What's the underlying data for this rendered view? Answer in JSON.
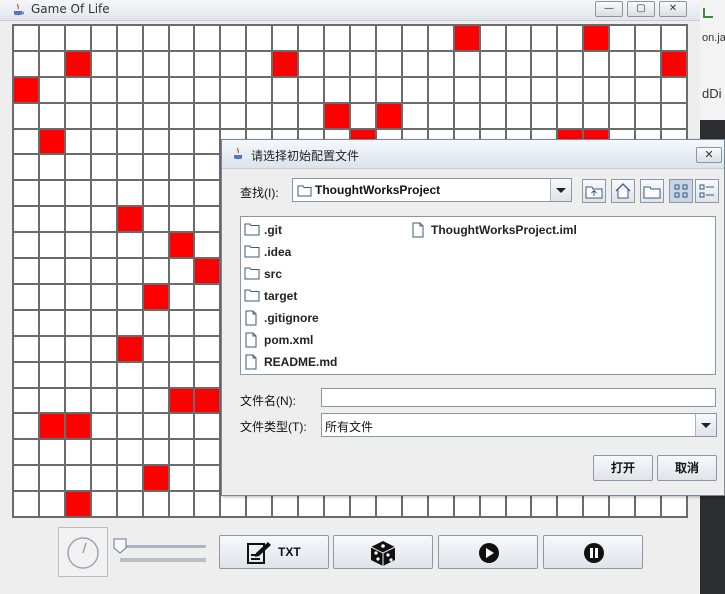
{
  "window": {
    "title": "Game Of Life",
    "minimize_glyph": "—",
    "maximize_glyph": "▢",
    "close_glyph": "✕"
  },
  "board": {
    "cols": 26,
    "rows": 19,
    "alive_color": "#ff0000",
    "alive_cells": [
      [
        0,
        17
      ],
      [
        0,
        22
      ],
      [
        1,
        2
      ],
      [
        1,
        10
      ],
      [
        1,
        25
      ],
      [
        2,
        0
      ],
      [
        3,
        12
      ],
      [
        3,
        14
      ],
      [
        4,
        1
      ],
      [
        4,
        13
      ],
      [
        4,
        21
      ],
      [
        4,
        22
      ],
      [
        5,
        10
      ],
      [
        5,
        17
      ],
      [
        6,
        9
      ],
      [
        6,
        17
      ],
      [
        7,
        4
      ],
      [
        8,
        6
      ],
      [
        9,
        7
      ],
      [
        10,
        5
      ],
      [
        12,
        4
      ],
      [
        14,
        6
      ],
      [
        14,
        7
      ],
      [
        15,
        1
      ],
      [
        15,
        2
      ],
      [
        17,
        5
      ],
      [
        18,
        2
      ],
      [
        19,
        6
      ],
      [
        19,
        8
      ]
    ]
  },
  "controls": {
    "speed_icon": "gauge-icon",
    "txt_label": "TXT",
    "txt_icon": "edit-file-icon",
    "random_icon": "dice-icon",
    "play_icon": "play-icon",
    "pause_icon": "pause-icon"
  },
  "side_strip": {
    "text_top": "on.ja",
    "text_mid": "dDi"
  },
  "dialog": {
    "title": "请选择初始配置文件",
    "close_glyph": "✕",
    "look_in_label": "查找(I):",
    "look_in_value": "ThoughtWorksProject",
    "toolbar_icons": [
      "up-folder-icon",
      "home-icon",
      "new-folder-icon",
      "list-view-icon",
      "details-view-icon"
    ],
    "files": [
      {
        "name": ".git",
        "kind": "folder"
      },
      {
        "name": ".idea",
        "kind": "folder"
      },
      {
        "name": "src",
        "kind": "folder"
      },
      {
        "name": "target",
        "kind": "folder"
      },
      {
        "name": ".gitignore",
        "kind": "file"
      },
      {
        "name": "pom.xml",
        "kind": "file"
      },
      {
        "name": "README.md",
        "kind": "file"
      },
      {
        "name": "ThoughtWorksProject.iml",
        "kind": "file"
      }
    ],
    "file_name_label": "文件名(N):",
    "file_name_value": "",
    "file_type_label": "文件类型(T):",
    "file_type_value": "所有文件",
    "open_label": "打开",
    "cancel_label": "取消"
  }
}
